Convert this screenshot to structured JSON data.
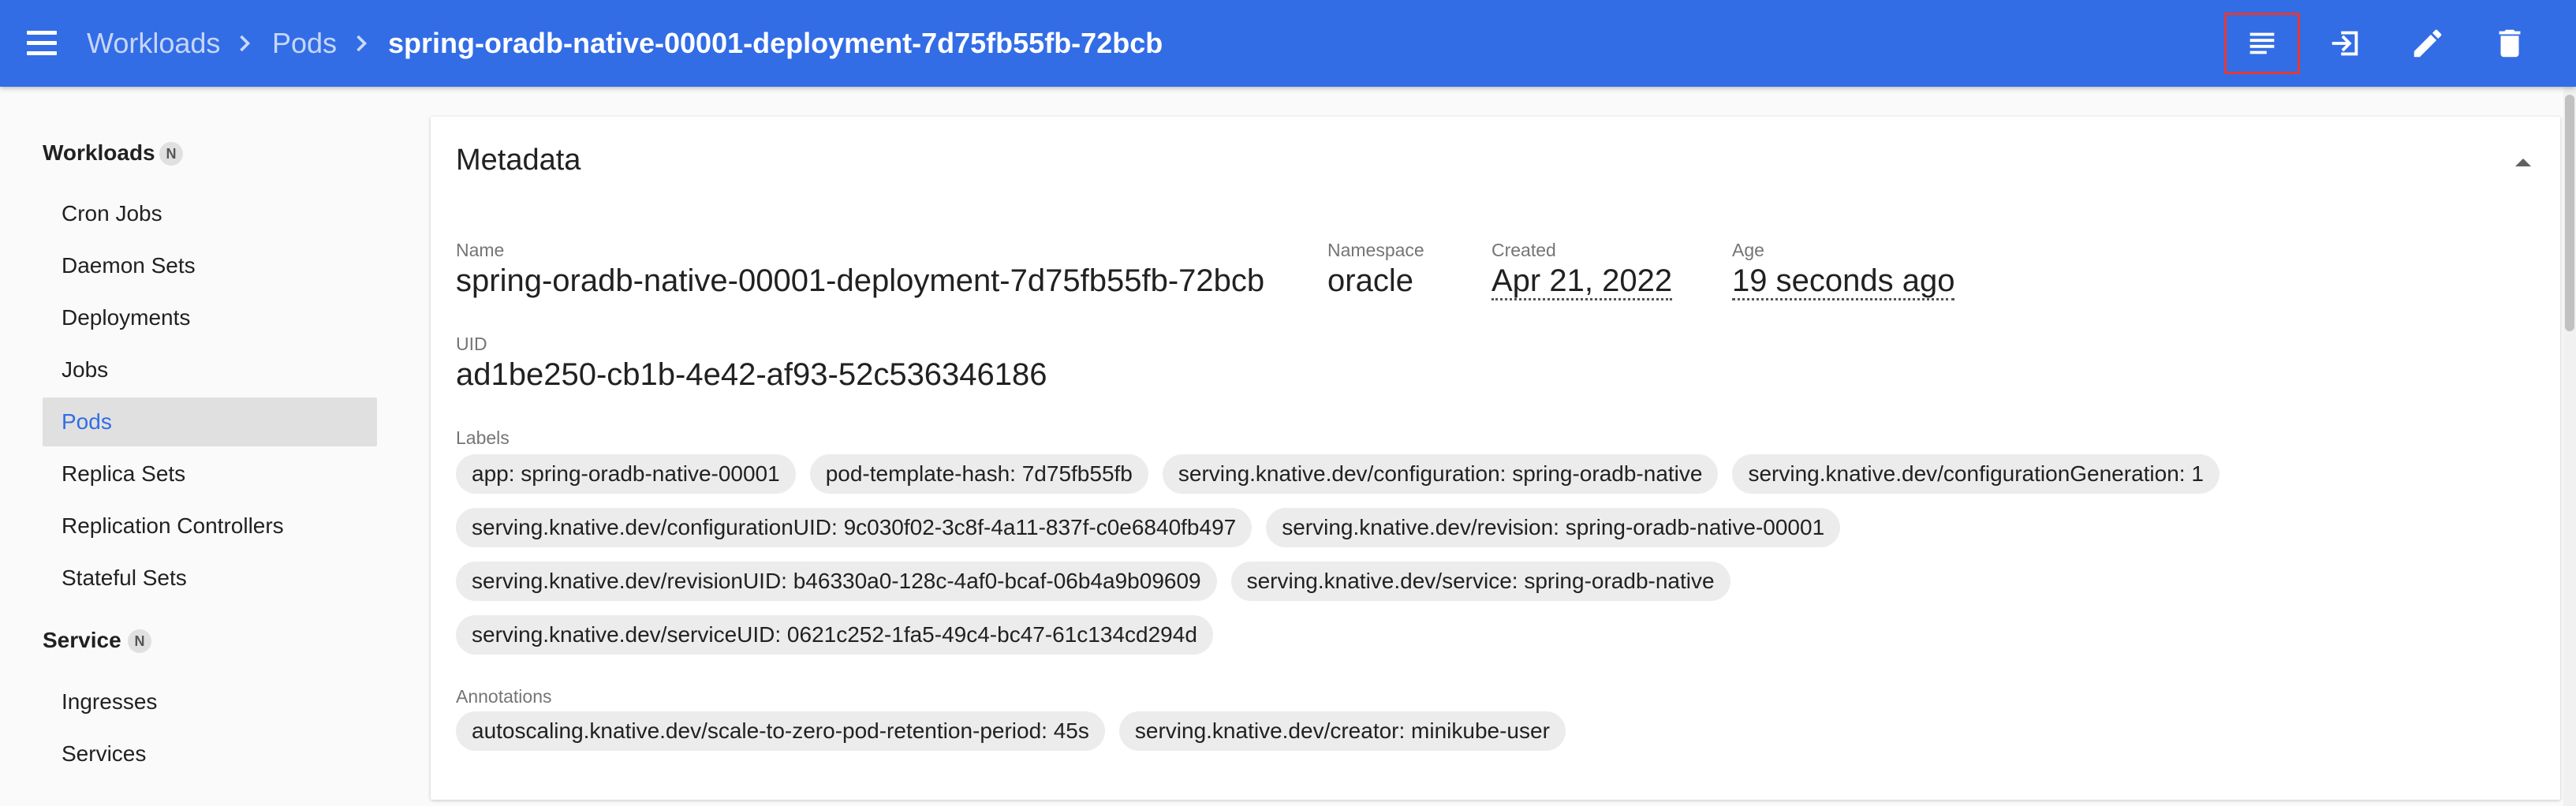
{
  "header": {
    "breadcrumbs": [
      "Workloads",
      "Pods"
    ],
    "title": "spring-oradb-native-00001-deployment-7d75fb55fb-72bcb",
    "actions": [
      {
        "name": "logs",
        "icon": "logs-icon"
      },
      {
        "name": "exec",
        "icon": "exec-icon"
      },
      {
        "name": "edit",
        "icon": "edit-icon"
      },
      {
        "name": "delete",
        "icon": "delete-icon"
      }
    ],
    "colors": {
      "bar": "#326de6",
      "highlight": "#e53935"
    }
  },
  "sidebar": {
    "sections": [
      {
        "title": "Workloads",
        "badge": "N",
        "items": [
          "Cron Jobs",
          "Daemon Sets",
          "Deployments",
          "Jobs",
          "Pods",
          "Replica Sets",
          "Replication Controllers",
          "Stateful Sets"
        ],
        "active": "Pods"
      },
      {
        "title": "Service",
        "badge": "N",
        "items": [
          "Ingresses",
          "Services"
        ]
      }
    ]
  },
  "metadata": {
    "title": "Metadata",
    "name_label": "Name",
    "name": "spring-oradb-native-00001-deployment-7d75fb55fb-72bcb",
    "namespace_label": "Namespace",
    "namespace": "oracle",
    "created_label": "Created",
    "created": "Apr 21, 2022",
    "age_label": "Age",
    "age": "19 seconds ago",
    "uid_label": "UID",
    "uid": "ad1be250-cb1b-4e42-af93-52c536346186",
    "labels_label": "Labels",
    "labels": [
      [
        "app: spring-oradb-native-00001",
        "pod-template-hash: 7d75fb55fb",
        "serving.knative.dev/configuration: spring-oradb-native",
        "serving.knative.dev/configurationGeneration: 1"
      ],
      [
        "serving.knative.dev/configurationUID: 9c030f02-3c8f-4a11-837f-c0e6840fb497",
        "serving.knative.dev/revision: spring-oradb-native-00001"
      ],
      [
        "serving.knative.dev/revisionUID: b46330a0-128c-4af0-bcaf-06b4a9b09609",
        "serving.knative.dev/service: spring-oradb-native"
      ],
      [
        "serving.knative.dev/serviceUID: 0621c252-1fa5-49c4-bc47-61c134cd294d"
      ]
    ],
    "annotations_label": "Annotations",
    "annotations": [
      "autoscaling.knative.dev/scale-to-zero-pod-retention-period: 45s",
      "serving.knative.dev/creator: minikube-user"
    ]
  }
}
